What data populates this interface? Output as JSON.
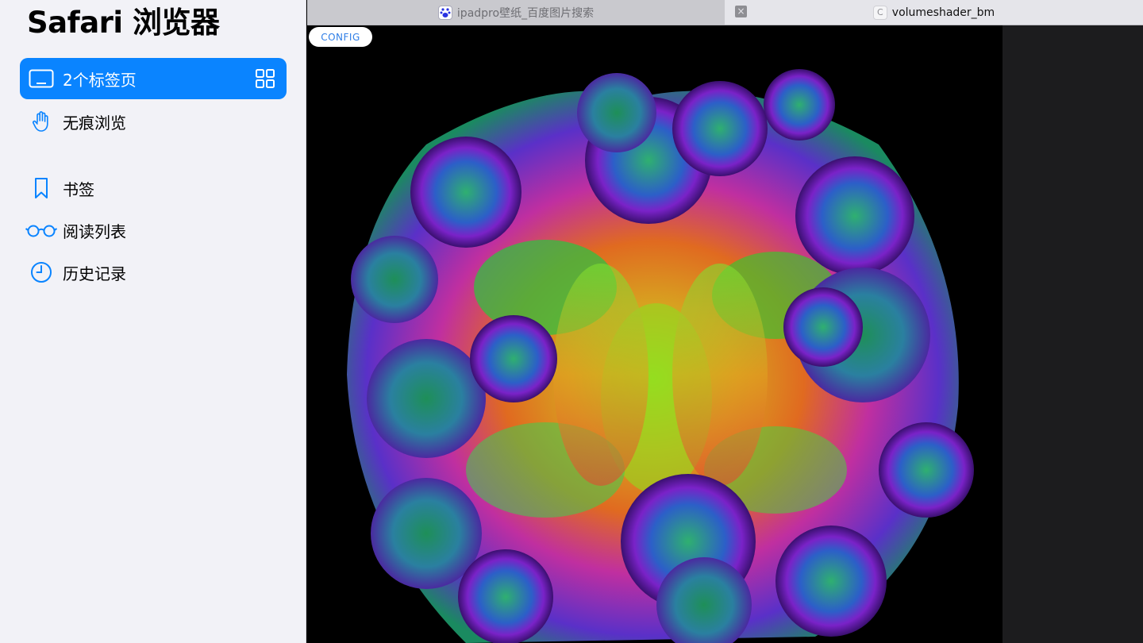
{
  "sidebar": {
    "title": "Safari 浏览器",
    "items": [
      {
        "label": "2个标签页",
        "icon": "tabs-icon",
        "selected": true,
        "trailing_icon": "tab-grid-icon"
      },
      {
        "label": "无痕浏览",
        "icon": "hand-icon"
      },
      {
        "label": "书签",
        "icon": "bookmark-icon"
      },
      {
        "label": "阅读列表",
        "icon": "glasses-icon"
      },
      {
        "label": "历史记录",
        "icon": "clock-icon"
      }
    ],
    "accent": "#0a84ff"
  },
  "tabs": [
    {
      "title": "ipadpro壁纸_百度图片搜索",
      "favicon": "baidu-paw-icon",
      "active": false
    },
    {
      "title": "volumeshader_bm",
      "favicon": "C",
      "active": true
    }
  ],
  "content": {
    "config_label": "CONFIG"
  }
}
